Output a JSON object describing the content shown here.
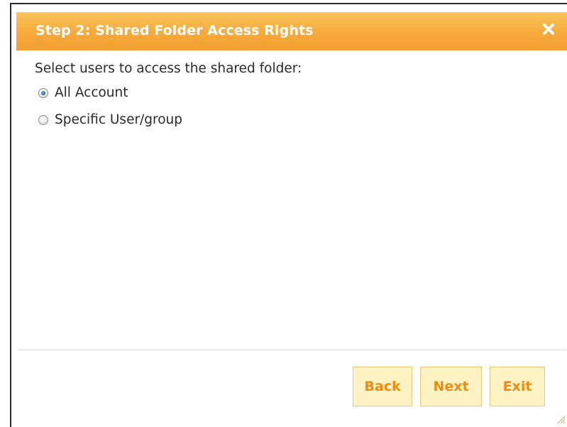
{
  "dialog": {
    "title": "Step 2: Shared Folder Access Rights",
    "accent_color": "#f6a93a"
  },
  "content": {
    "prompt": "Select users to access the shared folder:",
    "options": [
      {
        "label": "All Account",
        "checked": true
      },
      {
        "label": "Specific User/group",
        "checked": false
      }
    ]
  },
  "footer": {
    "back_label": "Back",
    "next_label": "Next",
    "exit_label": "Exit"
  },
  "icons": {
    "close": "close-icon",
    "resize": "resize-grip-icon"
  }
}
